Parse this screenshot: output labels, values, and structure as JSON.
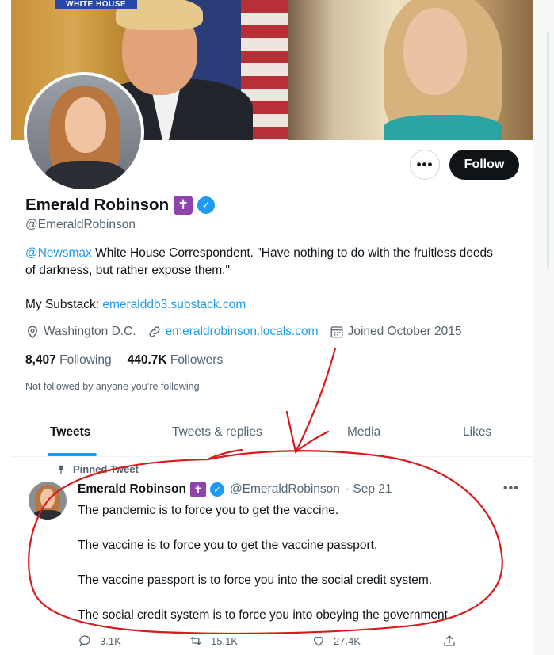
{
  "banner": {
    "caption": "WHITE HOUSE"
  },
  "profile": {
    "name": "Emerald Robinson",
    "cross_badge": "✝",
    "verified_badge": "✓",
    "handle": "@EmeraldRobinson",
    "bio_mention": "@Newsmax",
    "bio_text": " White House Correspondent. \"Have nothing to do with the fruitless deeds of darkness, but rather expose them.\"",
    "substack_label": "My Substack: ",
    "substack_link": "emeralddb3.substack.com",
    "location": "Washington D.C.",
    "website": "emeraldrobinson.locals.com",
    "joined": "Joined October 2015",
    "following_count": "8,407",
    "following_label": "Following",
    "followers_count": "440.7K",
    "followers_label": "Followers",
    "not_followed": "Not followed by anyone you’re following"
  },
  "buttons": {
    "more": "•••",
    "follow": "Follow"
  },
  "tabs": [
    {
      "label": "Tweets",
      "active": true
    },
    {
      "label": "Tweets & replies",
      "active": false
    },
    {
      "label": "Media",
      "active": false
    },
    {
      "label": "Likes",
      "active": false
    }
  ],
  "tweet": {
    "pinned_label": "Pinned Tweet",
    "name": "Emerald Robinson",
    "handle": "@EmeraldRobinson",
    "date": "· Sep 21",
    "more": "•••",
    "paragraphs": [
      "The pandemic is to force you to get the vaccine.",
      "The vaccine is to force you to get the vaccine passport.",
      "The vaccine passport is to force you into the social credit system.",
      "The social credit system is to force you into obeying the government."
    ],
    "replies": "3.1K",
    "retweets": "15.1K",
    "likes": "27.4K"
  },
  "colors": {
    "accent": "#1d9bf0",
    "text": "#0f1419",
    "secondary": "#536471",
    "annotation": "#d81b1b",
    "cross_badge": "#8e44ad"
  },
  "icons": [
    "location-icon",
    "link-icon",
    "calendar-icon",
    "pin-icon",
    "reply-icon",
    "retweet-icon",
    "like-icon",
    "share-icon"
  ]
}
